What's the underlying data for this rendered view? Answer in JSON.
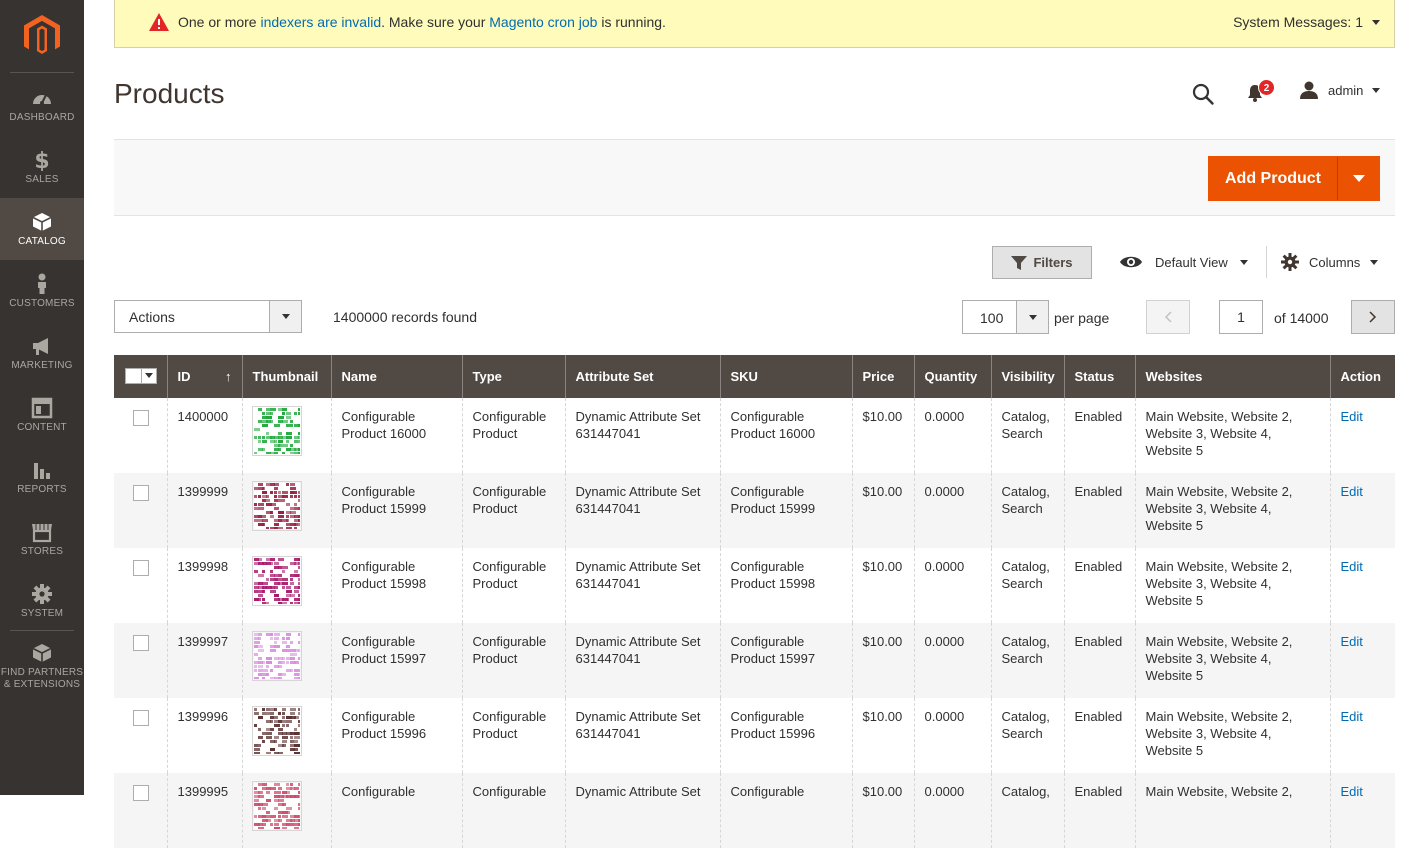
{
  "sidebar": {
    "items": [
      {
        "label": "DASHBOARD",
        "icon": "dashboard-icon"
      },
      {
        "label": "SALES",
        "icon": "dollar-icon"
      },
      {
        "label": "CATALOG",
        "icon": "box-icon",
        "active": true
      },
      {
        "label": "CUSTOMERS",
        "icon": "person-icon"
      },
      {
        "label": "MARKETING",
        "icon": "megaphone-icon"
      },
      {
        "label": "CONTENT",
        "icon": "layout-icon"
      },
      {
        "label": "REPORTS",
        "icon": "bar-chart-icon"
      },
      {
        "label": "STORES",
        "icon": "storefront-icon"
      },
      {
        "label": "SYSTEM",
        "icon": "gear-icon"
      }
    ],
    "partners_line1": "FIND PARTNERS",
    "partners_line2": "& EXTENSIONS"
  },
  "message": {
    "part1": "One or more ",
    "link1": "indexers are invalid",
    "part2": ". Make sure your ",
    "link2": "Magento cron job",
    "part3": " is running.",
    "system_messages": "System Messages: 1"
  },
  "header": {
    "title": "Products",
    "notifications_count": "2",
    "user": "admin"
  },
  "actionbar": {
    "add_product": "Add Product"
  },
  "toolbar": {
    "filters": "Filters",
    "default_view": "Default View",
    "columns": "Columns",
    "actions": "Actions",
    "records": "1400000 records found",
    "per_page_value": "100",
    "per_page_label": "per page",
    "page": "1",
    "of_pages": "of 14000"
  },
  "grid": {
    "headers": [
      "ID",
      "Thumbnail",
      "Name",
      "Type",
      "Attribute Set",
      "SKU",
      "Price",
      "Quantity",
      "Visibility",
      "Status",
      "Websites",
      "Action"
    ],
    "rows": [
      {
        "id": "1400000",
        "name": "Configurable Product 16000",
        "type": "Configurable Product",
        "attr": "Dynamic Attribute Set 631447041",
        "sku": "Configurable Product 16000",
        "price": "$10.00",
        "qty": "0.0000",
        "vis": "Catalog, Search",
        "status": "Enabled",
        "websites": "Main Website, Website 2, Website 3, Website 4, Website 5",
        "action": "Edit",
        "thumb_color": "#1ea83a"
      },
      {
        "id": "1399999",
        "name": "Configurable Product 15999",
        "type": "Configurable Product",
        "attr": "Dynamic Attribute Set 631447041",
        "sku": "Configurable Product 15999",
        "price": "$10.00",
        "qty": "0.0000",
        "vis": "Catalog, Search",
        "status": "Enabled",
        "websites": "Main Website, Website 2, Website 3, Website 4, Website 5",
        "action": "Edit",
        "thumb_color": "#9a1e3e"
      },
      {
        "id": "1399998",
        "name": "Configurable Product 15998",
        "type": "Configurable Product",
        "attr": "Dynamic Attribute Set 631447041",
        "sku": "Configurable Product 15998",
        "price": "$10.00",
        "qty": "0.0000",
        "vis": "Catalog, Search",
        "status": "Enabled",
        "websites": "Main Website, Website 2, Website 3, Website 4, Website 5",
        "action": "Edit",
        "thumb_color": "#a8186a"
      },
      {
        "id": "1399997",
        "name": "Configurable Product 15997",
        "type": "Configurable Product",
        "attr": "Dynamic Attribute Set 631447041",
        "sku": "Configurable Product 15997",
        "price": "$10.00",
        "qty": "0.0000",
        "vis": "Catalog, Search",
        "status": "Enabled",
        "websites": "Main Website, Website 2, Website 3, Website 4, Website 5",
        "action": "Edit",
        "thumb_color": "#d98ce0"
      },
      {
        "id": "1399996",
        "name": "Configurable Product 15996",
        "type": "Configurable Product",
        "attr": "Dynamic Attribute Set 631447041",
        "sku": "Configurable Product 15996",
        "price": "$10.00",
        "qty": "0.0000",
        "vis": "Catalog, Search",
        "status": "Enabled",
        "websites": "Main Website, Website 2, Website 3, Website 4, Website 5",
        "action": "Edit",
        "thumb_color": "#5a3030"
      },
      {
        "id": "1399995",
        "name": "Configurable",
        "type": "Configurable",
        "attr": "Dynamic Attribute Set",
        "sku": "Configurable",
        "price": "$10.00",
        "qty": "0.0000",
        "vis": "Catalog,",
        "status": "Enabled",
        "websites": "Main Website, Website 2,",
        "action": "Edit",
        "thumb_color": "#d04a6a"
      }
    ]
  },
  "colors": {
    "accent": "#eb5202",
    "sidebar": "#373330",
    "grid_header": "#514943",
    "link": "#006bb4"
  }
}
